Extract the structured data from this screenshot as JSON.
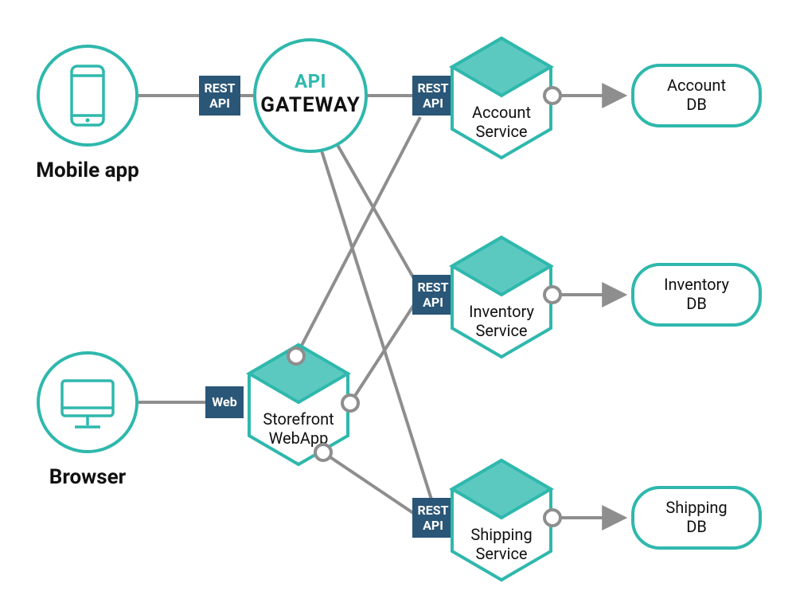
{
  "colors": {
    "teal": "#2fb8ad",
    "tealLight": "#5cc9c0",
    "navy": "#2a5677",
    "gray": "#8e8e8e",
    "outline": "#2fb8ad"
  },
  "clients": {
    "mobile": {
      "label": "Mobile app"
    },
    "browser": {
      "label": "Browser"
    }
  },
  "badges": {
    "rest1": "REST",
    "api1": "API",
    "rest2": "REST",
    "api2": "API",
    "rest3": "REST",
    "api3": "API",
    "rest4": "REST",
    "api4": "API",
    "web": "Web"
  },
  "gateway": {
    "line1": "API",
    "line2": "GATEWAY"
  },
  "services": {
    "storefront": {
      "line1": "Storefront",
      "line2": "WebApp"
    },
    "account": {
      "line1": "Account",
      "line2": "Service"
    },
    "inventory": {
      "line1": "Inventory",
      "line2": "Service"
    },
    "shipping": {
      "line1": "Shipping",
      "line2": "Service"
    }
  },
  "databases": {
    "account": {
      "line1": "Account",
      "line2": "DB"
    },
    "inventory": {
      "line1": "Inventory",
      "line2": "DB"
    },
    "shipping": {
      "line1": "Shipping",
      "line2": "DB"
    }
  }
}
